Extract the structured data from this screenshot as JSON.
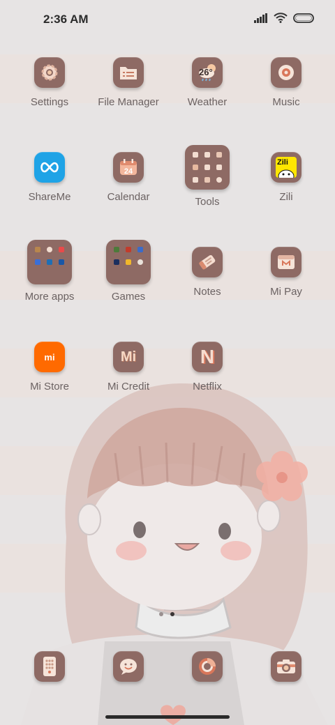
{
  "status_bar": {
    "time": "2:36 AM",
    "icons": [
      "signal-icon",
      "wifi-icon",
      "battery-icon"
    ]
  },
  "apps": [
    {
      "label": "Settings",
      "icon": "gear-icon"
    },
    {
      "label": "File Manager",
      "icon": "folder-icon"
    },
    {
      "label": "Weather",
      "icon": "weather-icon",
      "badge": "26°"
    },
    {
      "label": "Music",
      "icon": "music-icon"
    },
    {
      "label": "ShareMe",
      "icon": "shareme-icon"
    },
    {
      "label": "Calendar",
      "icon": "calendar-icon",
      "badge": "24"
    },
    {
      "label": "Tools",
      "icon": "tools-folder-icon"
    },
    {
      "label": "Zili",
      "icon": "zili-icon",
      "badge": "Zili"
    },
    {
      "label": "More apps",
      "icon": "more-apps-folder-icon"
    },
    {
      "label": "Games",
      "icon": "games-folder-icon"
    },
    {
      "label": "Notes",
      "icon": "notes-icon"
    },
    {
      "label": "Mi Pay",
      "icon": "mi-pay-icon"
    },
    {
      "label": "Mi Store",
      "icon": "mi-store-icon",
      "badge": "mi"
    },
    {
      "label": "Mi Credit",
      "icon": "mi-credit-icon",
      "badge": "Mi"
    },
    {
      "label": "Netflix",
      "icon": "netflix-icon",
      "badge": "N"
    }
  ],
  "page_indicator": {
    "pages": 2,
    "current": 2
  },
  "dock": [
    {
      "icon": "phone-dialer-icon"
    },
    {
      "icon": "messages-icon"
    },
    {
      "icon": "browser-icon"
    },
    {
      "icon": "camera-icon"
    }
  ],
  "colors": {
    "tile": "#8e6a64",
    "background": "#e7e4e4",
    "label": "#6b6262",
    "shareme_blue": "#1fa3e6",
    "mi_orange": "#ff6a00",
    "zili_yellow": "#ffe600"
  }
}
